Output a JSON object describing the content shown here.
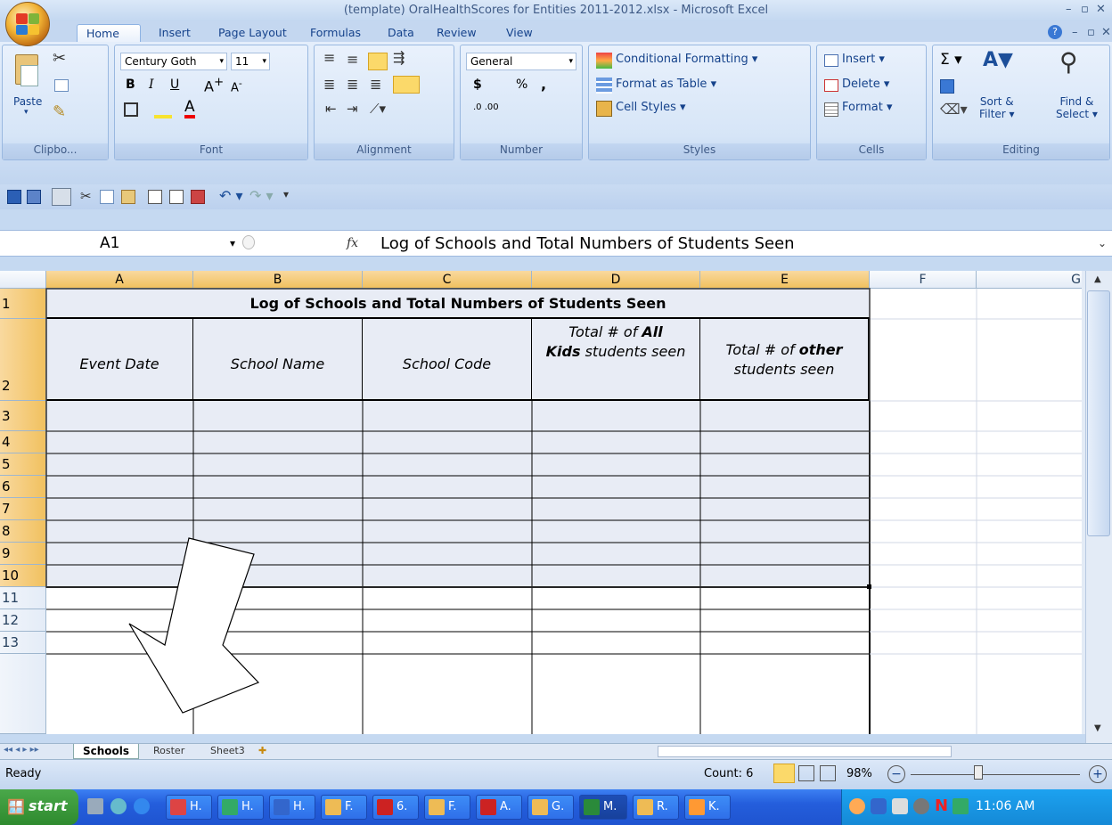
{
  "window": {
    "title": "(template) OralHealthScores for Entities 2011-2012.xlsx - Microsoft Excel"
  },
  "tabs": [
    "Home",
    "Insert",
    "Page Layout",
    "Formulas",
    "Data",
    "Review",
    "View"
  ],
  "ribbon": {
    "clipboard": {
      "paste": "Paste",
      "label": "Clipbo..."
    },
    "font": {
      "name": "Century Goth",
      "size": "11",
      "label": "Font",
      "bold": "B",
      "italic": "I",
      "underline": "U"
    },
    "alignment": {
      "label": "Alignment"
    },
    "number": {
      "format": "General",
      "currency": "$",
      "percent": "%",
      "comma": ",",
      "label": "Number"
    },
    "styles": {
      "conditional": "Conditional Formatting",
      "table": "Format as Table",
      "cell": "Cell Styles",
      "label": "Styles"
    },
    "cells": {
      "insert": "Insert",
      "delete": "Delete",
      "format": "Format",
      "label": "Cells"
    },
    "editing": {
      "sum": "Σ",
      "sort": "Sort &",
      "filter": "Filter",
      "find": "Find &",
      "select": "Select",
      "label": "Editing"
    }
  },
  "formula_bar": {
    "name_box": "A1",
    "fx": "fx",
    "content": "Log of Schools and Total Numbers of Students Seen"
  },
  "columns": [
    "A",
    "B",
    "C",
    "D",
    "E",
    "F",
    "G"
  ],
  "rows": [
    "1",
    "2",
    "3",
    "4",
    "5",
    "6",
    "7",
    "8",
    "9",
    "10",
    "11",
    "12",
    "13"
  ],
  "sheet": {
    "title": "Log of Schools and Total Numbers of Students Seen",
    "headers": {
      "event_date": "Event Date",
      "school_name": "School Name",
      "school_code": "School Code",
      "total_all_pre": "Total # of ",
      "total_all_bold": "All",
      "total_all_kids": "Kids",
      "total_all_post": " students seen",
      "total_other_pre": "Total # of ",
      "total_other_bold": "other",
      "total_other_post": "students seen"
    }
  },
  "sheet_tabs": [
    "Schools",
    "Roster",
    "Sheet3"
  ],
  "status": {
    "ready": "Ready",
    "count": "Count: 6",
    "zoom": "98%"
  },
  "taskbar": {
    "start": "start",
    "items": [
      "H.",
      "H.",
      "H.",
      "F.",
      "6.",
      "F.",
      "A.",
      "G.",
      "M.",
      "R.",
      "K."
    ],
    "clock": "11:06 AM"
  },
  "colors": {
    "selected_header": "#f1c15f",
    "shaded_rows": "#e8ecf5",
    "ribbon_text": "#15428b"
  }
}
